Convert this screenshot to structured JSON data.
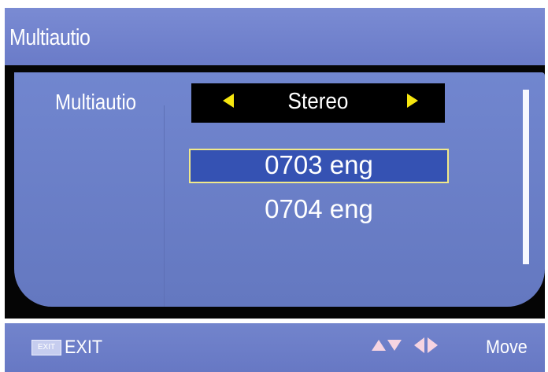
{
  "window": {
    "title": "Multiautio"
  },
  "multiaudio": {
    "label": "Multiautio",
    "selected_mode": "Stereo",
    "options": [
      "0703 eng",
      "0704 eng"
    ],
    "selected_option_index": 0
  },
  "footer": {
    "exit_key": "EXIT",
    "exit_label": "EXIT",
    "move_label": "Move"
  },
  "icons": {
    "left_arrow": "arrow-left-icon",
    "right_arrow": "arrow-right-icon",
    "up_arrow": "arrow-up-icon",
    "down_arrow": "arrow-down-icon"
  },
  "colors": {
    "panel_blue": "#6a7dc7",
    "selection_blue": "#3552b3",
    "arrow_yellow": "#f6e60f",
    "nav_pink": "#f6d4e1"
  }
}
